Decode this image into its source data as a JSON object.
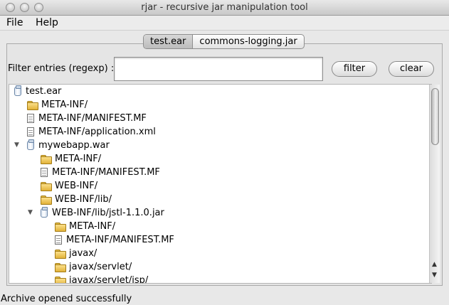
{
  "window": {
    "title": "rjar - recursive jar manipulation tool"
  },
  "menubar": {
    "items": [
      "File",
      "Help"
    ]
  },
  "tabs": [
    {
      "label": "test.ear",
      "active": true
    },
    {
      "label": "commons-logging.jar",
      "active": false
    }
  ],
  "filter": {
    "label": "Filter entries (regexp) :",
    "value": "",
    "filter_button": "filter",
    "clear_button": "clear"
  },
  "tree": {
    "items": [
      {
        "label": "test.ear",
        "icon": "jar-icon",
        "depth": 0,
        "expanded": null
      },
      {
        "label": "META-INF/",
        "icon": "folder-icon",
        "depth": 1
      },
      {
        "label": "META-INF/MANIFEST.MF",
        "icon": "file-icon",
        "depth": 1
      },
      {
        "label": "META-INF/application.xml",
        "icon": "file-icon",
        "depth": 1
      },
      {
        "label": "mywebapp.war",
        "icon": "jar-icon",
        "depth": 1,
        "expanded": true
      },
      {
        "label": "META-INF/",
        "icon": "folder-icon",
        "depth": 2
      },
      {
        "label": "META-INF/MANIFEST.MF",
        "icon": "file-icon",
        "depth": 2
      },
      {
        "label": "WEB-INF/",
        "icon": "folder-icon",
        "depth": 2
      },
      {
        "label": "WEB-INF/lib/",
        "icon": "folder-icon",
        "depth": 2
      },
      {
        "label": "WEB-INF/lib/jstl-1.1.0.jar",
        "icon": "jar-icon",
        "depth": 2,
        "expanded": true
      },
      {
        "label": "META-INF/",
        "icon": "folder-icon",
        "depth": 3
      },
      {
        "label": "META-INF/MANIFEST.MF",
        "icon": "file-icon",
        "depth": 3
      },
      {
        "label": "javax/",
        "icon": "folder-icon",
        "depth": 3
      },
      {
        "label": "javax/servlet/",
        "icon": "folder-icon",
        "depth": 3
      },
      {
        "label": "javax/servlet/jsp/",
        "icon": "folder-icon",
        "depth": 3
      }
    ]
  },
  "scrollbar": {
    "up_icon": "scroll-up-icon",
    "down_icon": "scroll-down-icon"
  },
  "status": {
    "text": "Archive opened successfully"
  }
}
